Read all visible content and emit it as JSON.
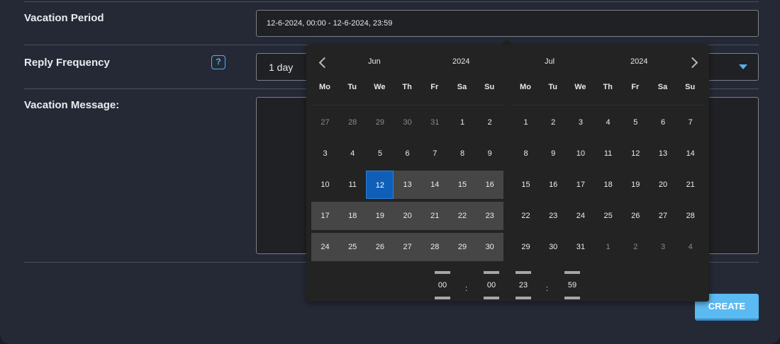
{
  "form": {
    "vacation_period_label": "Vacation Period",
    "vacation_period_value": "12-6-2024, 00:00 - 12-6-2024, 23:59",
    "reply_frequency_label": "Reply Frequency",
    "help_glyph": "?",
    "reply_frequency_value": "1 day",
    "vacation_message_label": "Vacation Message:",
    "vacation_message_value": "",
    "create_label": "CREATE"
  },
  "calendar": {
    "left": {
      "month": "Jun",
      "year": "2024",
      "weekdays": [
        "Mo",
        "Tu",
        "We",
        "Th",
        "Fr",
        "Sa",
        "Su"
      ],
      "weeks": [
        [
          {
            "d": "27",
            "s": "muted"
          },
          {
            "d": "28",
            "s": "muted"
          },
          {
            "d": "29",
            "s": "muted"
          },
          {
            "d": "30",
            "s": "muted"
          },
          {
            "d": "31",
            "s": "muted"
          },
          {
            "d": "1",
            "s": ""
          },
          {
            "d": "2",
            "s": ""
          }
        ],
        [
          {
            "d": "3",
            "s": ""
          },
          {
            "d": "4",
            "s": ""
          },
          {
            "d": "5",
            "s": ""
          },
          {
            "d": "6",
            "s": ""
          },
          {
            "d": "7",
            "s": ""
          },
          {
            "d": "8",
            "s": ""
          },
          {
            "d": "9",
            "s": ""
          }
        ],
        [
          {
            "d": "10",
            "s": ""
          },
          {
            "d": "11",
            "s": ""
          },
          {
            "d": "12",
            "s": "start"
          },
          {
            "d": "13",
            "s": "inrange"
          },
          {
            "d": "14",
            "s": "inrange"
          },
          {
            "d": "15",
            "s": "inrange"
          },
          {
            "d": "16",
            "s": "inrange"
          }
        ],
        [
          {
            "d": "17",
            "s": "inrange"
          },
          {
            "d": "18",
            "s": "inrange"
          },
          {
            "d": "19",
            "s": "inrange"
          },
          {
            "d": "20",
            "s": "inrange"
          },
          {
            "d": "21",
            "s": "inrange"
          },
          {
            "d": "22",
            "s": "inrange"
          },
          {
            "d": "23",
            "s": "inrange"
          }
        ],
        [
          {
            "d": "24",
            "s": "inrange"
          },
          {
            "d": "25",
            "s": "inrange"
          },
          {
            "d": "26",
            "s": "inrange"
          },
          {
            "d": "27",
            "s": "inrange"
          },
          {
            "d": "28",
            "s": "inrange"
          },
          {
            "d": "29",
            "s": "inrange"
          },
          {
            "d": "30",
            "s": "inrange"
          }
        ]
      ]
    },
    "right": {
      "month": "Jul",
      "year": "2024",
      "weekdays": [
        "Mo",
        "Tu",
        "We",
        "Th",
        "Fr",
        "Sa",
        "Su"
      ],
      "weeks": [
        [
          {
            "d": "1",
            "s": ""
          },
          {
            "d": "2",
            "s": ""
          },
          {
            "d": "3",
            "s": ""
          },
          {
            "d": "4",
            "s": ""
          },
          {
            "d": "5",
            "s": ""
          },
          {
            "d": "6",
            "s": ""
          },
          {
            "d": "7",
            "s": ""
          }
        ],
        [
          {
            "d": "8",
            "s": ""
          },
          {
            "d": "9",
            "s": ""
          },
          {
            "d": "10",
            "s": ""
          },
          {
            "d": "11",
            "s": ""
          },
          {
            "d": "12",
            "s": ""
          },
          {
            "d": "13",
            "s": ""
          },
          {
            "d": "14",
            "s": ""
          }
        ],
        [
          {
            "d": "15",
            "s": ""
          },
          {
            "d": "16",
            "s": ""
          },
          {
            "d": "17",
            "s": ""
          },
          {
            "d": "18",
            "s": ""
          },
          {
            "d": "19",
            "s": ""
          },
          {
            "d": "20",
            "s": ""
          },
          {
            "d": "21",
            "s": ""
          }
        ],
        [
          {
            "d": "22",
            "s": ""
          },
          {
            "d": "23",
            "s": ""
          },
          {
            "d": "24",
            "s": ""
          },
          {
            "d": "25",
            "s": ""
          },
          {
            "d": "26",
            "s": ""
          },
          {
            "d": "27",
            "s": ""
          },
          {
            "d": "28",
            "s": ""
          }
        ],
        [
          {
            "d": "29",
            "s": ""
          },
          {
            "d": "30",
            "s": ""
          },
          {
            "d": "31",
            "s": ""
          },
          {
            "d": "1",
            "s": "muted"
          },
          {
            "d": "2",
            "s": "muted"
          },
          {
            "d": "3",
            "s": "muted"
          },
          {
            "d": "4",
            "s": "muted"
          }
        ]
      ]
    },
    "start_time": {
      "hours": "00",
      "minutes": "00"
    },
    "end_time": {
      "hours": "23",
      "minutes": "59"
    },
    "time_separator": ":"
  },
  "colors": {
    "accent": "#4fb3ea",
    "range_start": "#0f5fb8",
    "range_fill": "#464646"
  }
}
